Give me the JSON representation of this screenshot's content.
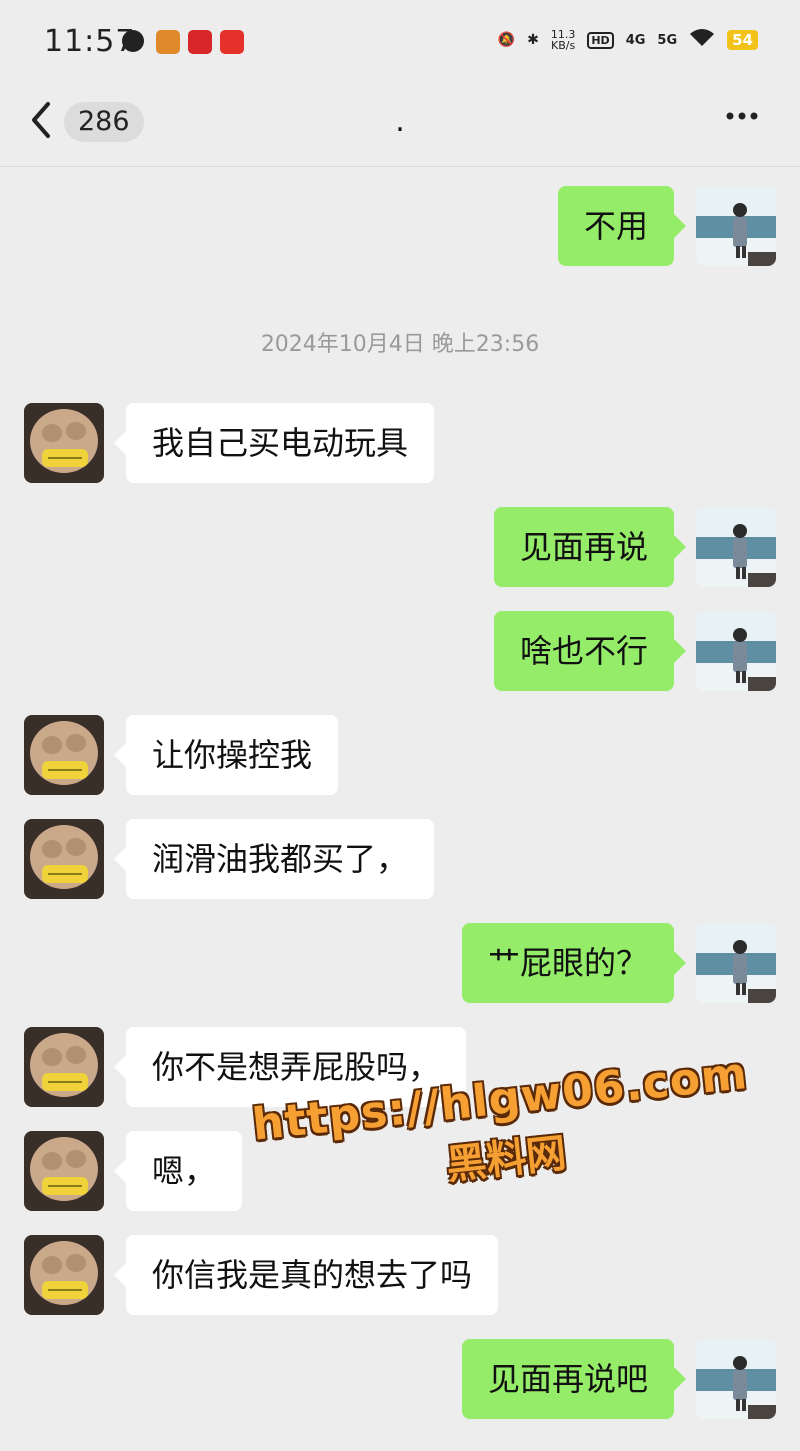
{
  "status_bar": {
    "time": "11:57",
    "speed_top": "11.3",
    "speed_bottom": "KB/s",
    "hd_label": "HD",
    "net1": "4G",
    "net2": "5G",
    "battery": "54"
  },
  "header": {
    "back_icon": "chevron-left",
    "unread_count": "286",
    "title": ".",
    "more_icon": "more-horizontal"
  },
  "timestamp": "2024年10月4日 晚上23:56",
  "messages": [
    {
      "side": "out",
      "text": "不用"
    },
    {
      "side": "in",
      "text": "我自己买电动玩具"
    },
    {
      "side": "out",
      "text": "见面再说"
    },
    {
      "side": "out",
      "text": "啥也不行"
    },
    {
      "side": "in",
      "text": "让你操控我"
    },
    {
      "side": "in",
      "text": "润滑油我都买了，"
    },
    {
      "side": "out",
      "text": "艹屁眼的？"
    },
    {
      "side": "in",
      "text": "你不是想弄屁股吗，"
    },
    {
      "side": "in",
      "text": "嗯，"
    },
    {
      "side": "in",
      "text": "你信我是真的想去了吗"
    },
    {
      "side": "out",
      "text": "见面再说吧"
    }
  ],
  "watermark": {
    "url": "https://hlgw06.com",
    "name": "黑料网"
  },
  "colors": {
    "background": "#ededed",
    "outgoing_bubble": "#95ec69",
    "incoming_bubble": "#ffffff",
    "watermark": "#f6a033"
  }
}
